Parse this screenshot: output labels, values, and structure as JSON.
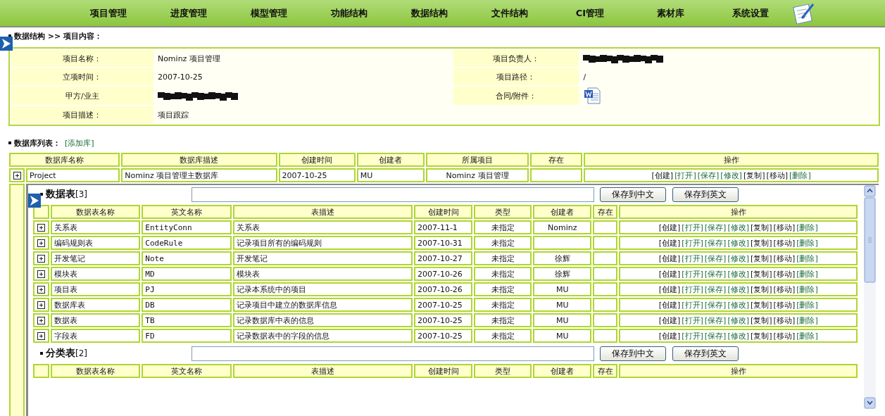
{
  "nav": {
    "items": [
      "项目管理",
      "进度管理",
      "模型管理",
      "功能结构",
      "数据结构",
      "文件结构",
      "CI管理",
      "素材库",
      "系统设置"
    ]
  },
  "breadcrumb": "数据结构 >> 项目内容：",
  "project_info": {
    "rows": [
      {
        "left": {
          "label": "项目名称：",
          "kind": "text",
          "value": "Nominz 项目管理"
        },
        "right": {
          "label": "项目负责人：",
          "kind": "redacted"
        }
      },
      {
        "left": {
          "label": "立项时间：",
          "kind": "text",
          "value": "2007-10-25"
        },
        "right": {
          "label": "项目路径：",
          "kind": "text",
          "value": "/"
        }
      },
      {
        "left": {
          "label": "甲方/业主",
          "kind": "redacted"
        },
        "right": {
          "label": "合同/附件：",
          "kind": "document"
        }
      },
      {
        "left": {
          "label": "项目描述：",
          "kind": "text",
          "value": "项目跟踪"
        }
      }
    ]
  },
  "database_list": {
    "title": "数据库列表：",
    "add_link": "[添加库]",
    "columns": [
      "数据库名称",
      "数据库描述",
      "创建时间",
      "创建者",
      "所属项目",
      "存在",
      "操作"
    ],
    "rows": [
      {
        "name": "Project",
        "description": "Nominz 项目管理主数据库",
        "created": "2007-10-25",
        "creator": "MU",
        "project": "Nominz 项目管理",
        "actions": [
          {
            "text": "[创建]",
            "link": false
          },
          {
            "text": "[打开]",
            "link": true
          },
          {
            "text": "[保存]",
            "link": true
          },
          {
            "text": "[修改]",
            "link": true
          },
          {
            "text": "[复制]",
            "link": false
          },
          {
            "text": "[移动]",
            "link": false
          },
          {
            "text": "[删除]",
            "link": true
          }
        ]
      }
    ]
  },
  "sections": [
    {
      "title": "数据表",
      "count": "[3]",
      "buttons": [
        "保存到中文",
        "保存到英文"
      ],
      "columns": [
        "数据表名称",
        "英文名称",
        "表描述",
        "创建时间",
        "类型",
        "创建者",
        "存在",
        "操作"
      ],
      "rows": [
        {
          "name": "关系表",
          "english": "EntityConn",
          "description": "关系表",
          "created": "2007-11-1",
          "type": "未指定",
          "creator": "Nominz",
          "actions": [
            {
              "text": "[创建]",
              "link": false
            },
            {
              "text": "[打开]",
              "link": true
            },
            {
              "text": "[保存]",
              "link": true
            },
            {
              "text": "[修改]",
              "link": true
            },
            {
              "text": "[复制]",
              "link": false
            },
            {
              "text": "[移动]",
              "link": false
            },
            {
              "text": "[删除]",
              "link": true
            }
          ]
        },
        {
          "name": "编码规则表",
          "english": "CodeRule",
          "description": "记录项目所有的编码规则",
          "created": "2007-10-31",
          "type": "未指定",
          "actions": [
            {
              "text": "[创建]",
              "link": false
            },
            {
              "text": "[打开]",
              "link": true
            },
            {
              "text": "[保存]",
              "link": true
            },
            {
              "text": "[修改]",
              "link": true
            },
            {
              "text": "[复制]",
              "link": false
            },
            {
              "text": "[移动]",
              "link": false
            },
            {
              "text": "[删除]",
              "link": true
            }
          ]
        },
        {
          "name": "开发笔记",
          "english": "Note",
          "description": "开发笔记",
          "created": "2007-10-27",
          "type": "未指定",
          "creator": "徐辉",
          "actions": [
            {
              "text": "[创建]",
              "link": false
            },
            {
              "text": "[打开]",
              "link": true
            },
            {
              "text": "[保存]",
              "link": true
            },
            {
              "text": "[修改]",
              "link": true
            },
            {
              "text": "[复制]",
              "link": false
            },
            {
              "text": "[移动]",
              "link": false
            },
            {
              "text": "[删除]",
              "link": true
            }
          ]
        },
        {
          "name": "模块表",
          "english": "MD",
          "description": "模块表",
          "created": "2007-10-26",
          "type": "未指定",
          "creator": "徐辉",
          "actions": [
            {
              "text": "[创建]",
              "link": false
            },
            {
              "text": "[打开]",
              "link": true
            },
            {
              "text": "[保存]",
              "link": true
            },
            {
              "text": "[修改]",
              "link": true
            },
            {
              "text": "[复制]",
              "link": false
            },
            {
              "text": "[移动]",
              "link": false
            },
            {
              "text": "[删除]",
              "link": true
            }
          ]
        },
        {
          "name": "项目表",
          "english": "PJ",
          "description": "记录本系统中的项目",
          "created": "2007-10-26",
          "type": "未指定",
          "creator": "MU",
          "actions": [
            {
              "text": "[创建]",
              "link": false
            },
            {
              "text": "[打开]",
              "link": true
            },
            {
              "text": "[保存]",
              "link": true
            },
            {
              "text": "[修改]",
              "link": true
            },
            {
              "text": "[复制]",
              "link": false
            },
            {
              "text": "[移动]",
              "link": false
            },
            {
              "text": "[删除]",
              "link": true
            }
          ]
        },
        {
          "name": "数据库表",
          "english": "DB",
          "description": "记录项目中建立的数据库信息",
          "created": "2007-10-25",
          "type": "未指定",
          "creator": "MU",
          "actions": [
            {
              "text": "[创建]",
              "link": false
            },
            {
              "text": "[打开]",
              "link": true
            },
            {
              "text": "[保存]",
              "link": true
            },
            {
              "text": "[修改]",
              "link": true
            },
            {
              "text": "[复制]",
              "link": false
            },
            {
              "text": "[移动]",
              "link": false
            },
            {
              "text": "[删除]",
              "link": true
            }
          ]
        },
        {
          "name": "数据表",
          "english": "TB",
          "description": "记录数据库中表的信息",
          "created": "2007-10-25",
          "type": "未指定",
          "creator": "MU",
          "actions": [
            {
              "text": "[创建]",
              "link": false
            },
            {
              "text": "[打开]",
              "link": true
            },
            {
              "text": "[保存]",
              "link": true
            },
            {
              "text": "[修改]",
              "link": true
            },
            {
              "text": "[复制]",
              "link": false
            },
            {
              "text": "[移动]",
              "link": false
            },
            {
              "text": "[删除]",
              "link": true
            }
          ]
        },
        {
          "name": "字段表",
          "english": "FD",
          "description": "记录数据表中的字段的信息",
          "created": "2007-10-25",
          "type": "未指定",
          "creator": "MU",
          "actions": [
            {
              "text": "[创建]",
              "link": false
            },
            {
              "text": "[打开]",
              "link": true
            },
            {
              "text": "[保存]",
              "link": true
            },
            {
              "text": "[修改]",
              "link": true
            },
            {
              "text": "[复制]",
              "link": false
            },
            {
              "text": "[移动]",
              "link": false
            },
            {
              "text": "[删除]",
              "link": true
            }
          ]
        }
      ]
    },
    {
      "title": "分类表",
      "count": "[2]",
      "buttons": [
        "保存到中文",
        "保存到英文"
      ],
      "columns": [
        "数据表名称",
        "英文名称",
        "表描述",
        "创建时间",
        "类型",
        "创建者",
        "存在",
        "操作"
      ]
    }
  ]
}
